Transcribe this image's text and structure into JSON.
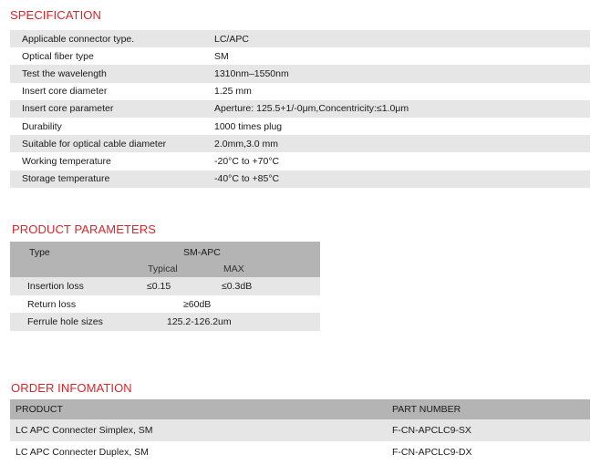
{
  "specification": {
    "title": "SPECIFICATION",
    "rows": [
      {
        "label": "Applicable connector type.",
        "value": "LC/APC"
      },
      {
        "label": "Optical fiber type",
        "value": "SM"
      },
      {
        "label": "Test the wavelength",
        "value": "1310nm–1550nm"
      },
      {
        "label": "Insert core diameter",
        "value": "1.25 mm"
      },
      {
        "label": "Insert core parameter",
        "value": "Aperture: 125.5+1/-0μm,Concentricity:≤1.0μm"
      },
      {
        "label": "Durability",
        "value": "1000 times plug"
      },
      {
        "label": "Suitable for optical cable diameter",
        "value": "2.0mm,3.0 mm"
      },
      {
        "label": "Working temperature",
        "value": "-20°C to +70°C"
      },
      {
        "label": "Storage temperature",
        "value": "-40°C to +85°C"
      }
    ]
  },
  "parameters": {
    "title": "PRODUCT PARAMETERS",
    "type_label": "Type",
    "type_value": "SM-APC",
    "typical_label": "Typical",
    "max_label": "MAX",
    "insertion_loss": {
      "label": "Insertion loss",
      "typical": "≤0.15",
      "max": "≤0.3dB"
    },
    "return_loss": {
      "label": "Return loss",
      "value": "≥60dB"
    },
    "ferrule": {
      "label": "Ferrule hole sizes",
      "value": "125.2-126.2um"
    }
  },
  "order": {
    "title": "ORDER INFOMATION",
    "col_product": "PRODUCT",
    "col_part": "PART NUMBER",
    "rows": [
      {
        "product": "LC  APC Connecter Simplex, SM",
        "part": "F-CN-APCLC9-SX"
      },
      {
        "product": "LC  APC Connecter Duplex, SM",
        "part": "F-CN-APCLC9-DX"
      }
    ]
  }
}
